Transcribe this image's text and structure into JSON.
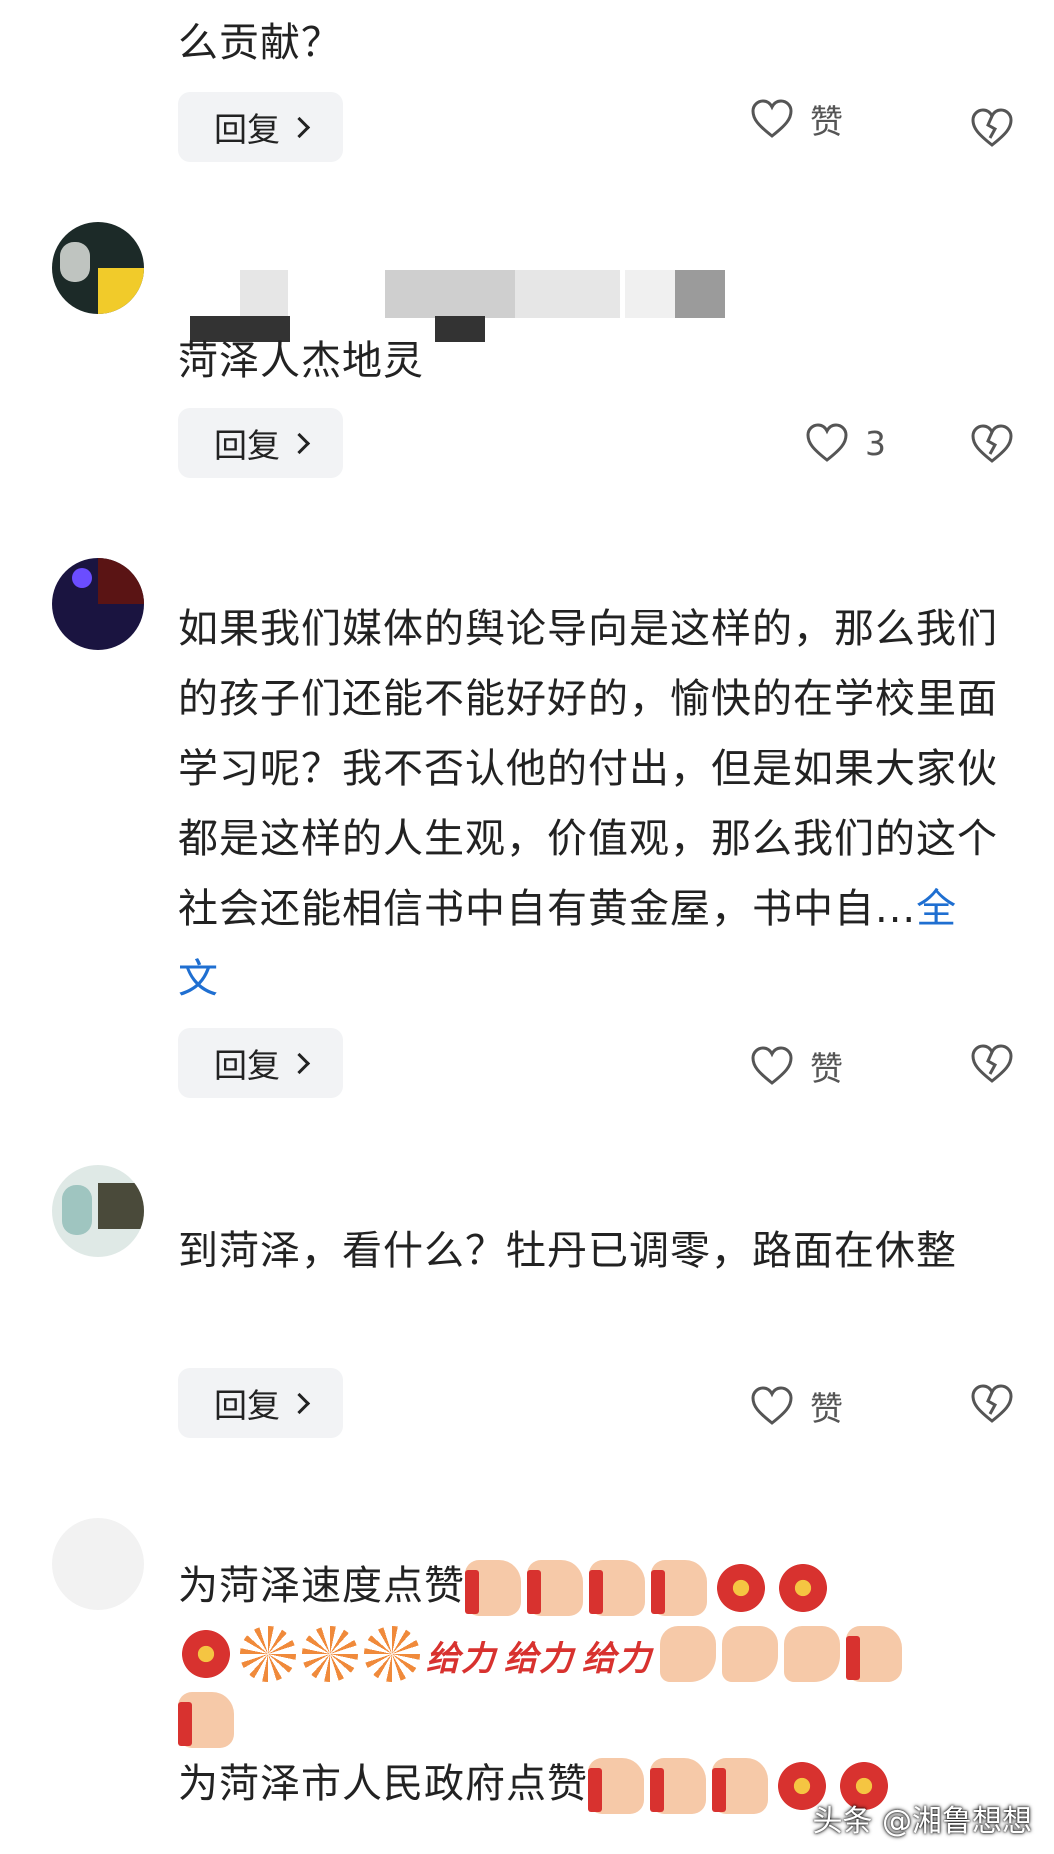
{
  "comments": [
    {
      "text": "么贡献？",
      "reply_label": "回复",
      "like_label": "赞"
    },
    {
      "text": "菏泽人杰地灵",
      "reply_label": "回复",
      "like_count": "3"
    },
    {
      "text": "如果我们媒体的舆论导向是这样的，那么我们的孩子们还能不能好好的，愉快的在学校里面学习呢？我不否认他的付出，但是如果大家伙都是这样的人生观，价值观，那么我们的这个社会还能相信书中自有黄金屋，书中自...",
      "more_label": "全文",
      "reply_label": "回复",
      "like_label": "赞"
    },
    {
      "text": "到菏泽，看什么？牡丹已调零，路面在休整",
      "reply_label": "回复",
      "like_label": "赞"
    },
    {
      "line1": "为菏泽速度点赞",
      "geili": "给力",
      "line2": "为菏泽市人民政府点赞"
    }
  ],
  "icons": [
    "heart-outline-icon",
    "broken-heart-icon",
    "chevron-right-icon",
    "thumbs-up-emoji",
    "ribbon-emoji",
    "firework-emoji",
    "flexed-arm-emoji"
  ],
  "watermark": "头条 @湘鲁想想",
  "colors": {
    "link": "#1f6fd1",
    "button_bg": "#f2f3f5",
    "text": "#222222",
    "icon": "#555555"
  }
}
